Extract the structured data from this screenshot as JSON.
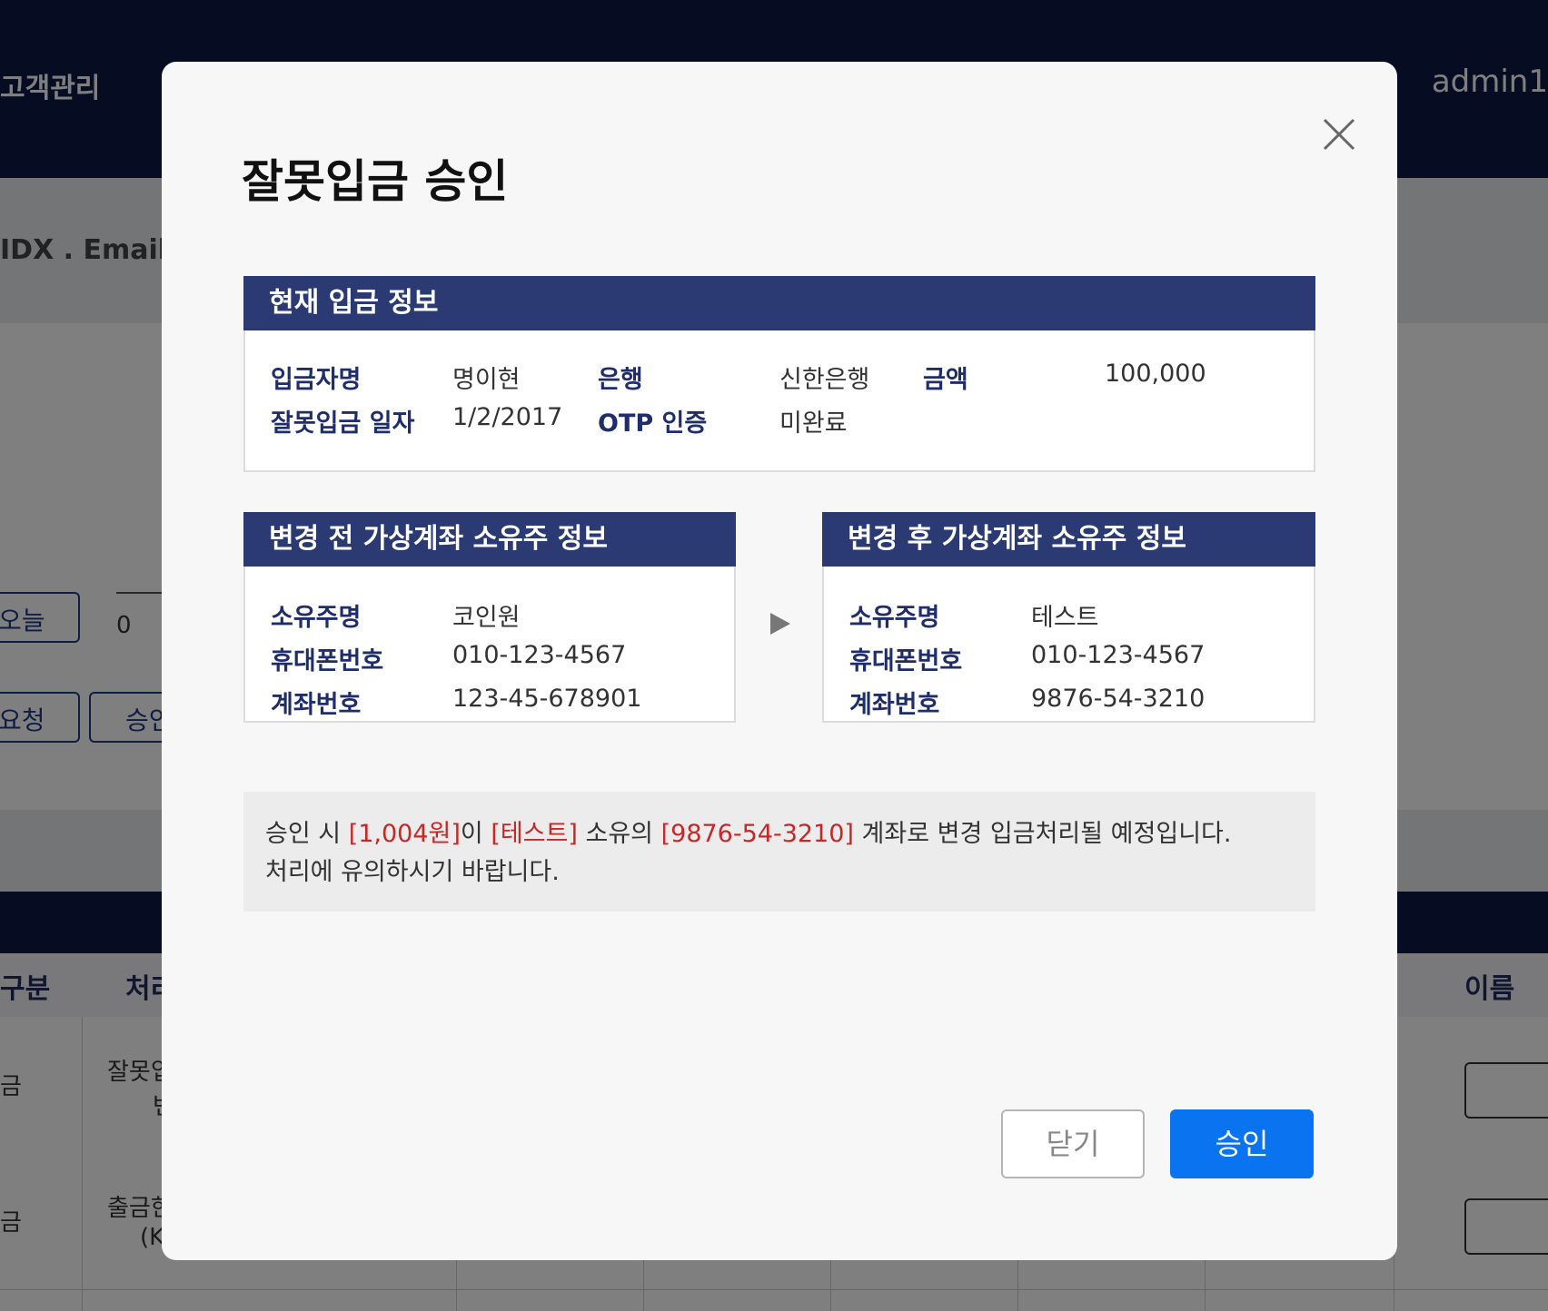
{
  "background": {
    "nav_item": "고객관리",
    "user": "admin1",
    "search_label": "IDX . Email . C",
    "btn_today": "오늘",
    "btn_request": "요청",
    "btn_approve": "승인",
    "date_value": "0",
    "table_headers": {
      "col1": "구분",
      "col2": "처리",
      "col_name": "이름"
    },
    "rows": [
      {
        "type": "금",
        "desc1": "잘못입",
        "desc2": "변"
      },
      {
        "type": "금",
        "desc1": "출금한",
        "desc2": "(K"
      }
    ]
  },
  "modal": {
    "title": "잘못입금 승인",
    "current": {
      "heading": "현재 입금 정보",
      "depositor_label": "입금자명",
      "depositor": "명이현",
      "bank_label": "은행",
      "bank": "신한은행",
      "amount_label": "금액",
      "amount": "100,000",
      "date_label": "잘못입금 일자",
      "date": "1/2/2017",
      "otp_label": "OTP 인증",
      "otp": "미완료"
    },
    "before": {
      "heading": "변경 전 가상계좌 소유주 정보",
      "owner_label": "소유주명",
      "owner": "코인원",
      "phone_label": "휴대폰번호",
      "phone": "010-123-4567",
      "account_label": "계좌번호",
      "account": "123-45-678901"
    },
    "after": {
      "heading": "변경 후 가상계좌 소유주 정보",
      "owner_label": "소유주명",
      "owner": "테스트",
      "phone_label": "휴대폰번호",
      "phone": "010-123-4567",
      "account_label": "계좌번호",
      "account": "9876-54-3210"
    },
    "notice": {
      "p1": "승인 시 ",
      "amount": "[1,004원]",
      "p2": "이 ",
      "owner": "[테스트]",
      "p3": " 소유의 ",
      "account": "[9876-54-3210]",
      "p4": " 계좌로 변경 입금처리될 예정입니다.",
      "line2": "처리에 유의하시기 바랍니다."
    },
    "close_label": "닫기",
    "approve_label": "승인"
  },
  "colors": {
    "header_bg": "#0c1a44",
    "section_head": "#2b3a72",
    "primary": "#0a74f0",
    "highlight": "#c62828"
  }
}
